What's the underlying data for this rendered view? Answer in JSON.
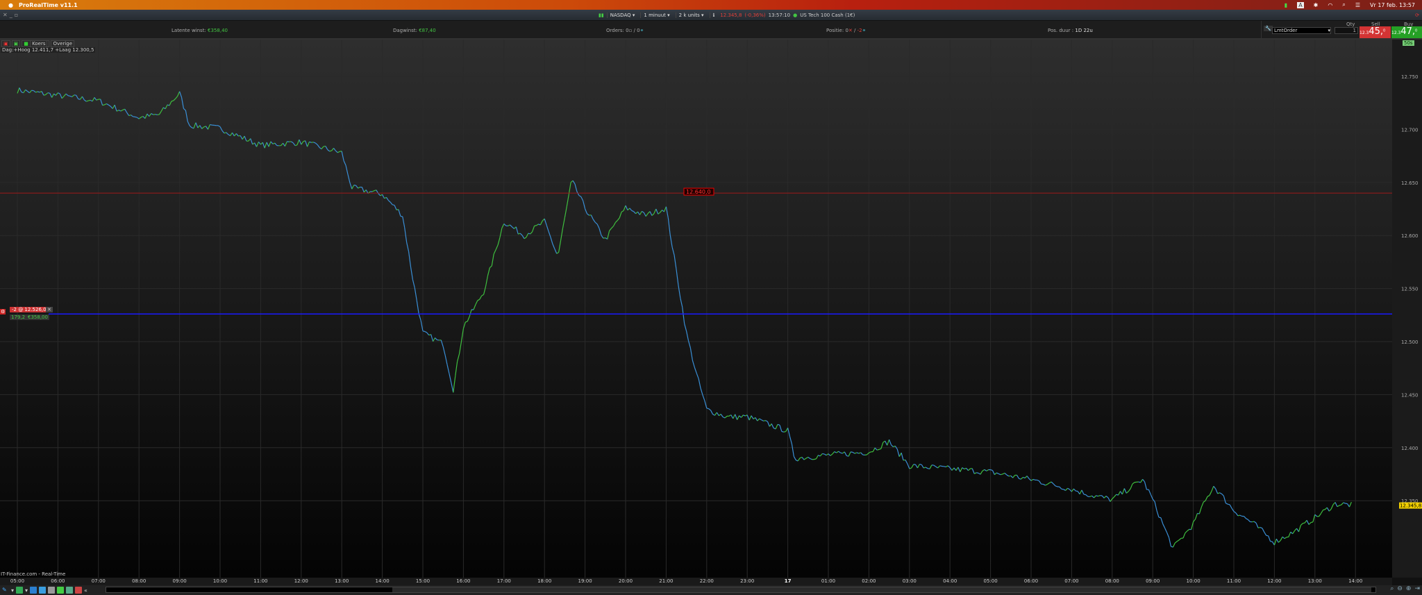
{
  "menubar": {
    "app": "ProRealTime v11.1",
    "clock": "Vr 17 feb. 13:57",
    "input_source": "A"
  },
  "toolbar": {
    "market": "NASDAQ",
    "interval": "1 minuut",
    "units": "2 k units",
    "price": "12.345,8",
    "change": "(-0,36%)",
    "time": "13:57:10",
    "instrument": "US Tech 100 Cash (1€)"
  },
  "infobar": {
    "latent_label": "Latente winst:",
    "latent_value": "€358,40",
    "day_label": "Dagwinst:",
    "day_value": "€87,40",
    "orders_label": "Orders:",
    "orders_a": "0",
    "orders_b": "0",
    "position_label": "Positie:",
    "position_a": "0",
    "position_b": "-2",
    "duration_label": "Pos. duur :",
    "duration_value": "1D 22u"
  },
  "order_panel": {
    "order_type": "LmtOrder",
    "qty_label": "Qty",
    "qty": "1",
    "sell_label": "Sell",
    "sell_prefix": "12.3",
    "sell_big": "45,",
    "sell_sup": "0",
    "buy_label": "Buy",
    "buy_prefix": "12.3",
    "buy_big": "47,",
    "buy_sup": "0",
    "timer": "50s"
  },
  "legend": {
    "price": "Koers",
    "other": "Overige",
    "day": "Dag:+Hoog 12.411,7 +Laag 12.300,5"
  },
  "position_tag": {
    "label": "-2 @ 12.526,0",
    "points": "179,2",
    "pnl": "€358,00"
  },
  "source": "IT-Finance.com - Real-Time",
  "colors": {
    "up": "#3fbf3f",
    "down": "#3a8fd6",
    "position_line": "#1a1aff",
    "alert_line": "#a01818",
    "last_price": "#f2d000"
  },
  "chart_data": {
    "type": "line",
    "y_ticks": [
      "12.750",
      "12.700",
      "12.650",
      "12.600",
      "12.550",
      "12.500",
      "12.450",
      "12.400",
      "12.350"
    ],
    "ylim": [
      12290,
      12770
    ],
    "x_ticks": [
      "05:00",
      "06:00",
      "07:00",
      "08:00",
      "09:00",
      "10:00",
      "11:00",
      "12:00",
      "13:00",
      "14:00",
      "15:00",
      "16:00",
      "17:00",
      "18:00",
      "19:00",
      "20:00",
      "21:00",
      "22:00",
      "23:00",
      "17",
      "01:00",
      "02:00",
      "03:00",
      "04:00",
      "05:00",
      "06:00",
      "07:00",
      "08:00",
      "09:00",
      "10:00",
      "11:00",
      "12:00",
      "13:00",
      "14:00"
    ],
    "alert_level": {
      "value": 12640,
      "label": "12.640,0"
    },
    "position_level": 12526,
    "last_price": {
      "value": 12345.8,
      "label": "12.345,8"
    },
    "series_hours_since_first_tick": "x in hours from 05:00 (16 feb)",
    "points": [
      [
        0,
        12737
      ],
      [
        2,
        12727
      ],
      [
        3,
        12711
      ],
      [
        3.5,
        12714
      ],
      [
        4,
        12734
      ],
      [
        4.25,
        12704
      ],
      [
        5,
        12701
      ],
      [
        6,
        12685
      ],
      [
        7,
        12688
      ],
      [
        8,
        12678
      ],
      [
        8.25,
        12645
      ],
      [
        9,
        12639
      ],
      [
        9.5,
        12619
      ],
      [
        9.75,
        12560
      ],
      [
        10,
        12508
      ],
      [
        10.5,
        12498
      ],
      [
        10.75,
        12455
      ],
      [
        11,
        12514
      ],
      [
        11.5,
        12547
      ],
      [
        12,
        12613
      ],
      [
        12.5,
        12600
      ],
      [
        13,
        12613
      ],
      [
        13.33,
        12580
      ],
      [
        13.67,
        12652
      ],
      [
        14,
        12626
      ],
      [
        14.5,
        12596
      ],
      [
        15,
        12626
      ],
      [
        15.5,
        12619
      ],
      [
        16,
        12626
      ],
      [
        16.25,
        12567
      ],
      [
        16.5,
        12508
      ],
      [
        16.75,
        12469
      ],
      [
        17,
        12436
      ],
      [
        17.5,
        12429
      ],
      [
        18,
        12429
      ],
      [
        19,
        12416
      ],
      [
        19.17,
        12390
      ],
      [
        20,
        12393
      ],
      [
        21,
        12396
      ],
      [
        21.5,
        12406
      ],
      [
        22,
        12383
      ],
      [
        23,
        12380
      ],
      [
        24,
        12377
      ],
      [
        25,
        12370
      ],
      [
        26,
        12361
      ],
      [
        26.5,
        12355
      ],
      [
        27,
        12351
      ],
      [
        27.75,
        12370
      ],
      [
        28,
        12351
      ],
      [
        28.5,
        12305
      ],
      [
        29,
        12328
      ],
      [
        29.5,
        12364
      ],
      [
        30,
        12341
      ],
      [
        30.5,
        12328
      ],
      [
        31,
        12311
      ],
      [
        31.5,
        12321
      ],
      [
        32,
        12334
      ],
      [
        32.5,
        12347
      ],
      [
        32.95,
        12346
      ]
    ]
  }
}
